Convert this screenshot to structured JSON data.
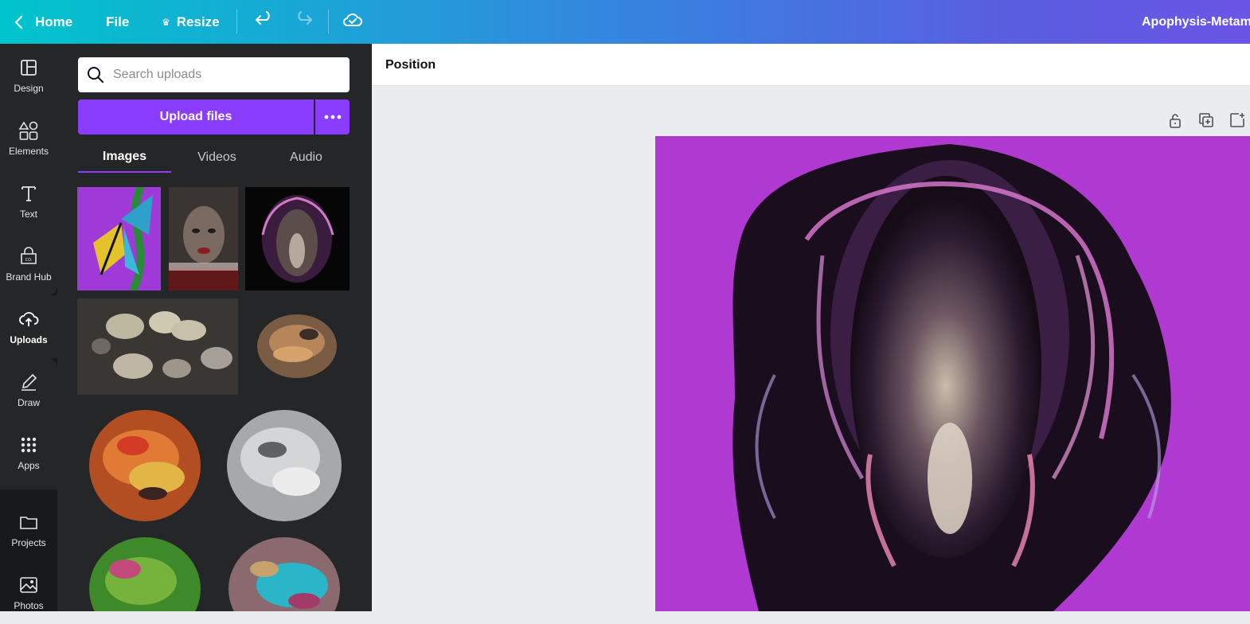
{
  "topbar": {
    "home_label": "Home",
    "file_label": "File",
    "resize_label": "Resize",
    "title": "Apophysis-Metam",
    "icons": [
      "chevron-left-icon",
      "crown-icon",
      "undo-icon",
      "redo-icon",
      "cloud-saved-icon"
    ]
  },
  "rail": {
    "items": [
      {
        "label": "Design",
        "icon": "design-layout-icon"
      },
      {
        "label": "Elements",
        "icon": "elements-shapes-icon"
      },
      {
        "label": "Text",
        "icon": "text-icon"
      },
      {
        "label": "Brand Hub",
        "icon": "brand-hub-icon"
      },
      {
        "label": "Uploads",
        "icon": "cloud-upload-icon",
        "active": true
      },
      {
        "label": "Draw",
        "icon": "draw-pen-icon"
      },
      {
        "label": "Apps",
        "icon": "apps-grid-icon"
      },
      {
        "label": "Projects",
        "icon": "folder-icon"
      },
      {
        "label": "Photos",
        "icon": "photo-icon"
      }
    ]
  },
  "panel": {
    "search_placeholder": "Search uploads",
    "upload_button": "Upload files",
    "tabs": [
      {
        "label": "Images",
        "active": true
      },
      {
        "label": "Videos"
      },
      {
        "label": "Audio"
      }
    ]
  },
  "context_toolbar": {
    "position_label": "Position"
  },
  "colors": {
    "accent": "#8b3dff",
    "rail_bg": "#18191b",
    "panel_bg": "#252627",
    "page_bg": "#b03ad1"
  }
}
